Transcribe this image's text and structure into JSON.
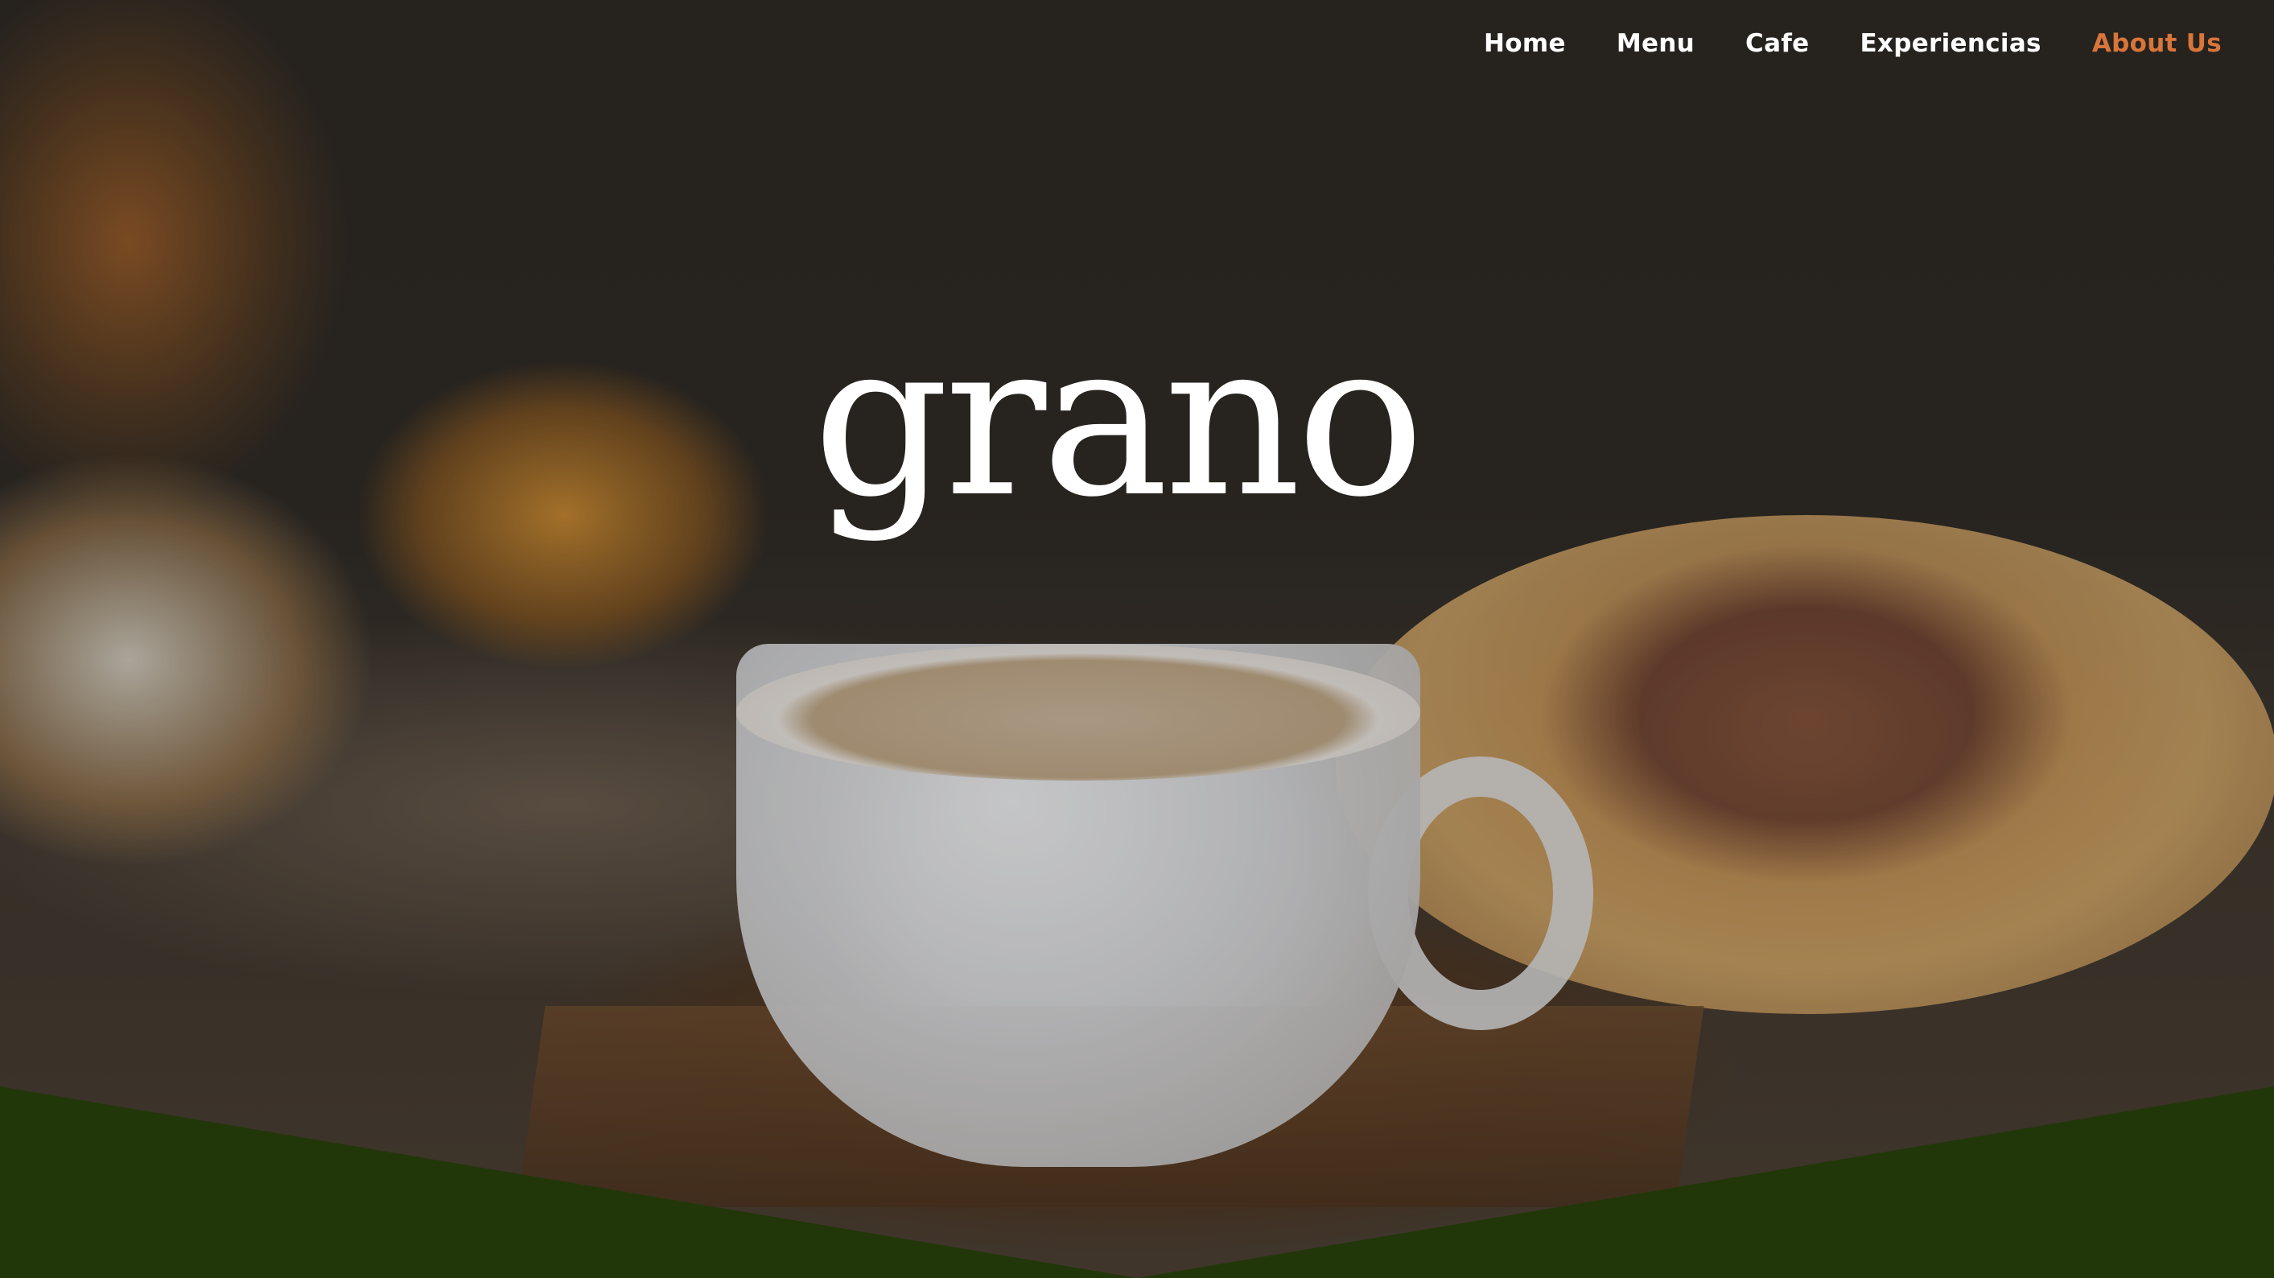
{
  "nav": {
    "items": [
      {
        "label": "Home"
      },
      {
        "label": "Menu"
      },
      {
        "label": "Cafe"
      },
      {
        "label": "Experiencias"
      },
      {
        "label": "About Us"
      }
    ],
    "active_color": "#d8753a"
  },
  "hero": {
    "logo_text": "grano",
    "background_description_colors": {
      "band": "#223709"
    }
  }
}
